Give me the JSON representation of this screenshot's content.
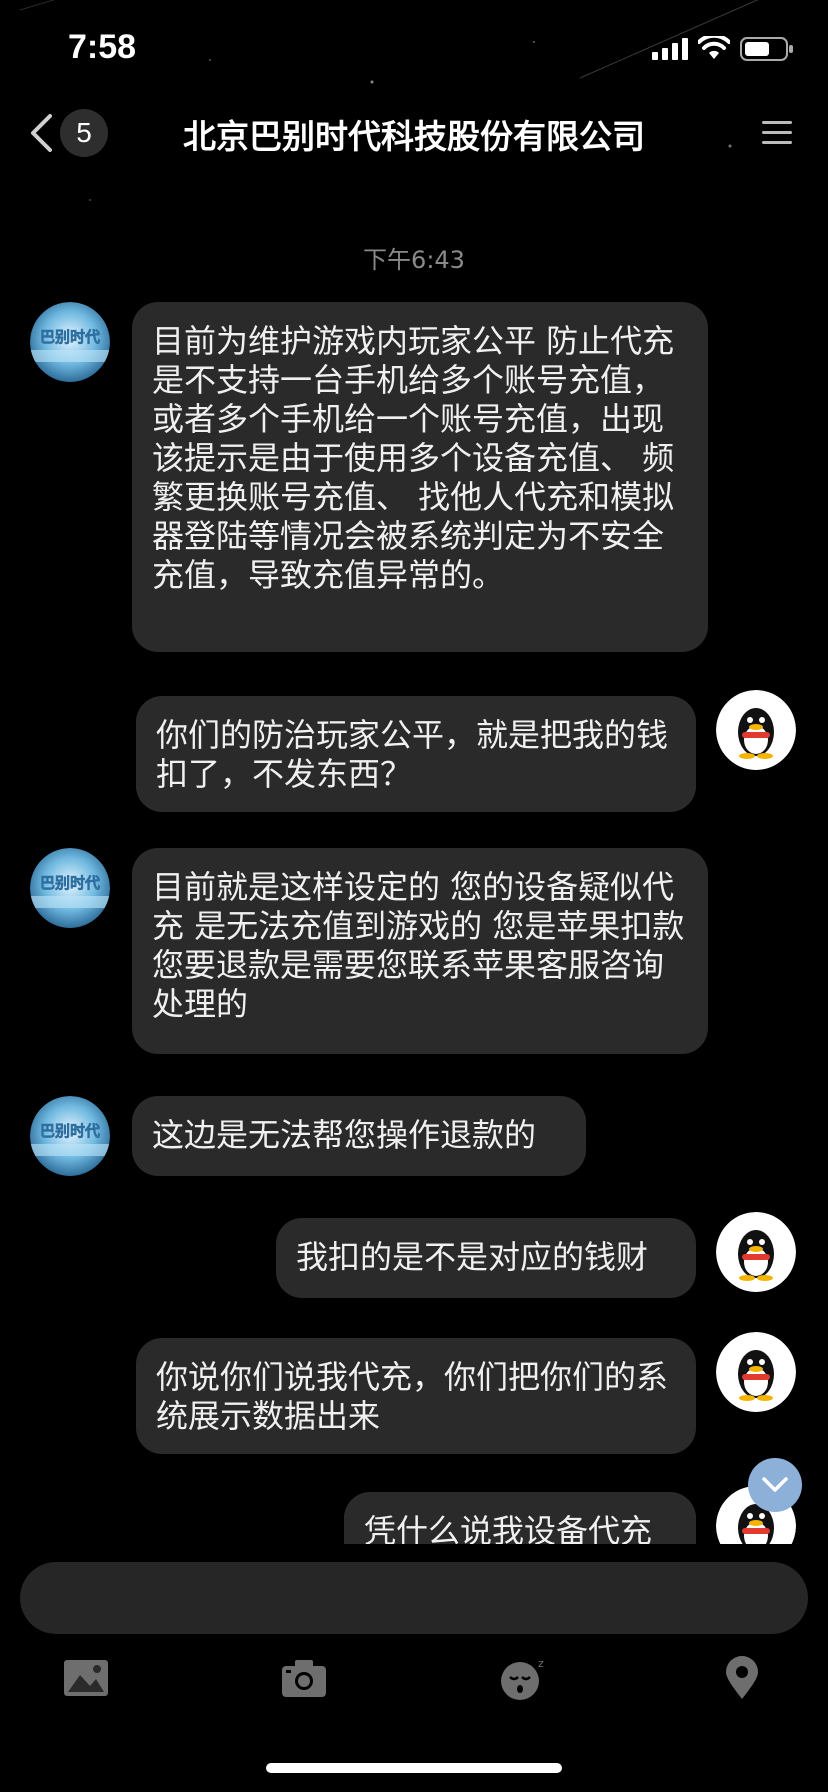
{
  "status_bar": {
    "time": "7:58"
  },
  "nav": {
    "unread_count": "5",
    "title": "北京巴别时代科技股份有限公司"
  },
  "chat": {
    "timestamp": "下午6:43",
    "messages": [
      {
        "side": "left",
        "text": "目前为维护游戏内玩家公平  防止代充  是不支持一台手机给多个账号充值，或者多个手机给一个账号充值，出现该提示是由于使用多个设备充值、 频繁更换账号充值、 找他人代充和模拟器登陆等情况会被系统判定为不安全充值，导致充值异常的。"
      },
      {
        "side": "right",
        "text": "你们的防治玩家公平，就是把我的钱扣了，不发东西？"
      },
      {
        "side": "left",
        "text": "目前就是这样设定的  您的设备疑似代充 是无法充值到游戏的   您是苹果扣款  您要退款是需要您联系苹果客服咨询处理的"
      },
      {
        "side": "left",
        "text": "这边是无法帮您操作退款的"
      },
      {
        "side": "right",
        "text": "我扣的是不是对应的钱财"
      },
      {
        "side": "right",
        "text": "你说你们说我代充，你们把你们的系统展示数据出来"
      },
      {
        "side": "right",
        "text": "凭什么说我设备代充"
      }
    ],
    "company_avatar_text": "巴别时代"
  },
  "toolbar": {
    "icons": [
      "image-icon",
      "camera-icon",
      "emoji-icon",
      "location-icon"
    ]
  },
  "colors": {
    "background": "#000000",
    "bubble": "#2a2a2a",
    "scroll_button": "#8db0d8"
  }
}
